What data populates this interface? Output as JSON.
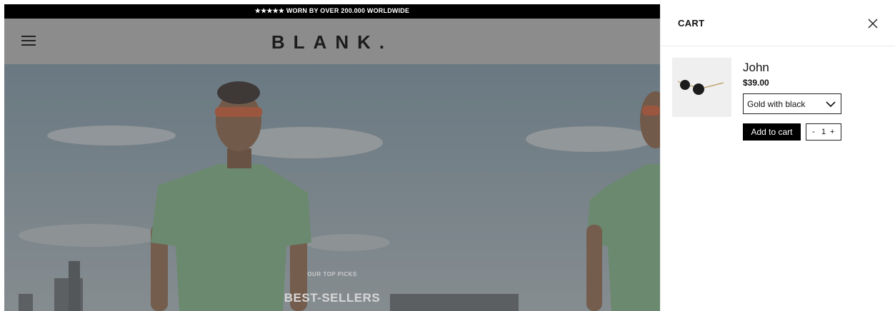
{
  "announcement": "★★★★★ WORN BY OVER 200.000 WORLDWIDE",
  "header": {
    "logo": "BLANK."
  },
  "hero": {
    "eyebrow": "OUR TOP PICKS",
    "title": "BEST-SELLERS"
  },
  "cart": {
    "title": "CART",
    "item": {
      "name": "John",
      "price": "$39.00",
      "variant": "Gold with black",
      "add_label": "Add to cart",
      "minus": "-",
      "quantity": "1",
      "plus": "+"
    }
  }
}
